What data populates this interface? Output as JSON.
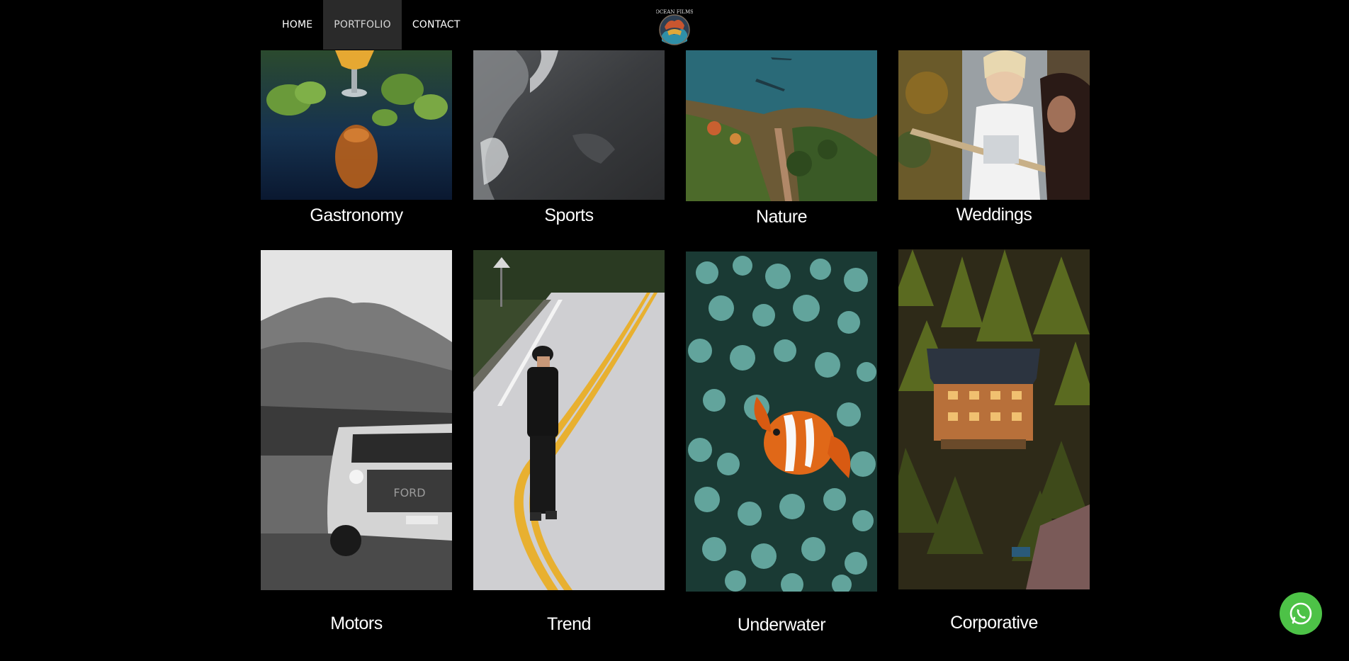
{
  "nav": {
    "items": [
      {
        "label": "HOME"
      },
      {
        "label": "PORTFOLIO"
      },
      {
        "label": "CONTACT"
      }
    ]
  },
  "logo": {
    "text_top": "OCEAN FILMS",
    "icon": "ocean-films-logo"
  },
  "gallery": {
    "tiles": [
      {
        "label": "Gastronomy",
        "image": "beer-glass-hops-photo"
      },
      {
        "label": "Sports",
        "image": "surf-wave-photo"
      },
      {
        "label": "Nature",
        "image": "aerial-coast-photo"
      },
      {
        "label": "Weddings",
        "image": "wedding-party-photo"
      },
      {
        "label": "Motors",
        "image": "pickup-truck-mountain-photo"
      },
      {
        "label": "Trend",
        "image": "man-on-road-photo"
      },
      {
        "label": "Underwater",
        "image": "clownfish-anemone-photo"
      },
      {
        "label": "Corporative",
        "image": "forest-cabin-aerial-photo"
      }
    ]
  },
  "whatsapp": {
    "icon": "whatsapp-icon",
    "color": "#4dc247"
  },
  "colors": {
    "background": "#000000",
    "nav_active": "#2a2a2a",
    "text": "#ffffff"
  }
}
